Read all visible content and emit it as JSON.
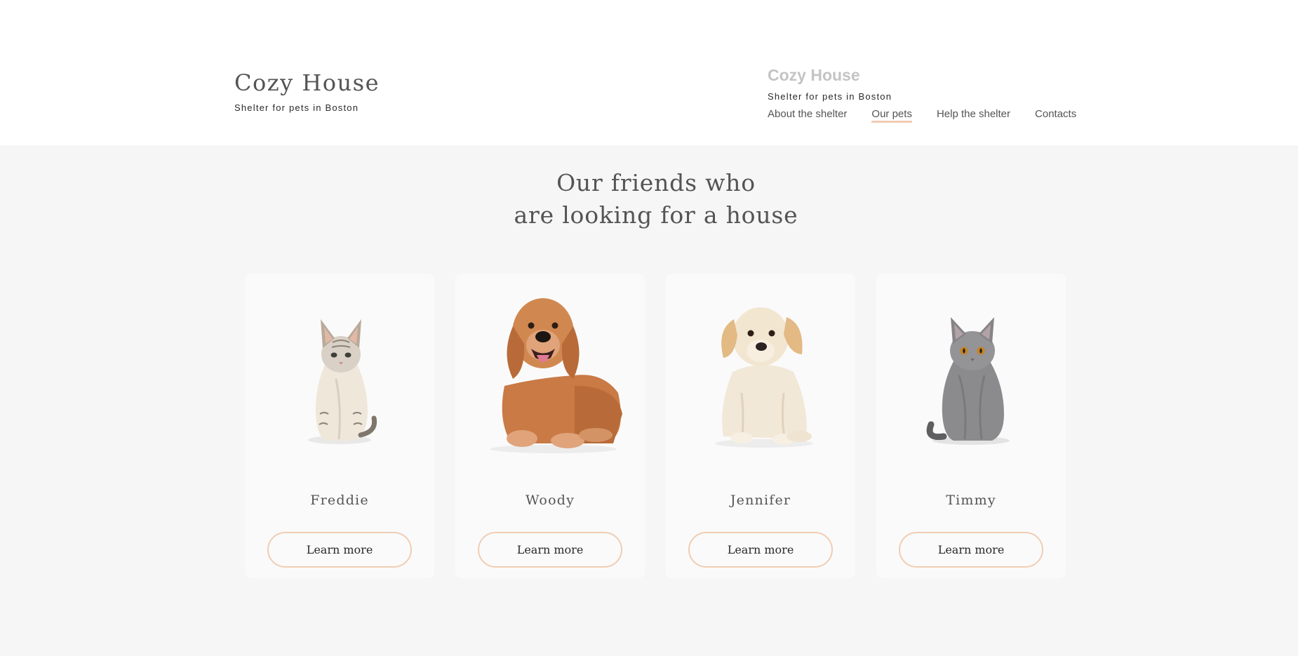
{
  "header": {
    "logo": {
      "title": "Cozy House",
      "subtitle": "Shelter for pets in Boston"
    },
    "logo_alt": {
      "title": "Cozy House",
      "subtitle": "Shelter for pets in Boston"
    },
    "nav": [
      {
        "label": "About the shelter",
        "active": false
      },
      {
        "label": "Our pets",
        "active": true
      },
      {
        "label": "Help the shelter",
        "active": false
      },
      {
        "label": "Contacts",
        "active": false
      }
    ]
  },
  "main": {
    "title_line1": "Our friends who",
    "title_line2": "are looking for a house",
    "pets": [
      {
        "name": "Freddie",
        "button_label": "Learn more",
        "icon": "cat-photo"
      },
      {
        "name": "Woody",
        "button_label": "Learn more",
        "icon": "dog-photo"
      },
      {
        "name": "Jennifer",
        "button_label": "Learn more",
        "icon": "puppy-photo"
      },
      {
        "name": "Timmy",
        "button_label": "Learn more",
        "icon": "cat-photo"
      }
    ]
  },
  "colors": {
    "accent": "#f1cdb3",
    "text_dark": "#545454",
    "text_black": "#292929",
    "page_bg": "#f6f6f6",
    "card_bg": "#fafafa"
  }
}
